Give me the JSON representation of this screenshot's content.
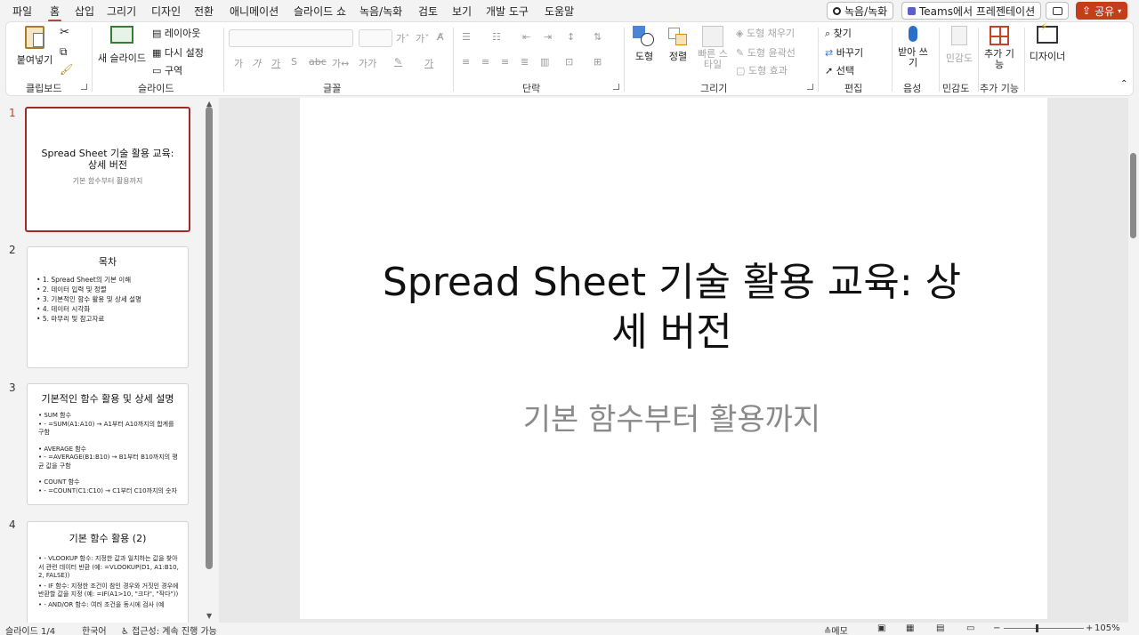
{
  "menu": {
    "items": [
      "파일",
      "홈",
      "삽입",
      "그리기",
      "디자인",
      "전환",
      "애니메이션",
      "슬라이드 쇼",
      "녹음/녹화",
      "검토",
      "보기",
      "개발 도구",
      "도움말"
    ],
    "record_button": "녹음/녹화",
    "teams_button": "Teams에서 프레젠테이션",
    "share_button": "공유"
  },
  "ribbon": {
    "clipboard": {
      "paste": "붙여넣기",
      "label": "클립보드"
    },
    "slides": {
      "new_slide": "새 슬라이드",
      "layout": "레이아웃",
      "reset": "다시 설정",
      "section": "구역",
      "label": "슬라이드"
    },
    "font": {
      "label": "글꼴"
    },
    "paragraph": {
      "label": "단락"
    },
    "drawing": {
      "shapes": "도형",
      "arrange": "정렬",
      "quick_styles": "빠른 스타일",
      "fill": "도형 채우기",
      "outline": "도형 윤곽선",
      "effects": "도형 효과",
      "label": "그리기"
    },
    "editing": {
      "find": "찾기",
      "replace": "바꾸기",
      "select": "선택",
      "label": "편집"
    },
    "voice": {
      "dictate": "받아 쓰기",
      "label": "음성"
    },
    "sensitivity": {
      "button": "민감도",
      "label": "민감도"
    },
    "addins": {
      "button": "추가 기능",
      "label": "추가 기능"
    },
    "designer": {
      "button": "디자이너"
    }
  },
  "thumbnails": [
    {
      "num": "1",
      "title": "Spread Sheet 기술 활용 교육: 상세 버전",
      "subtitle": "기본 함수부터 활용까지"
    },
    {
      "num": "2",
      "title": "목차",
      "items": [
        "1. Spread Sheet의 기본 이해",
        "2. 데이터 입력 및 정렬",
        "3. 기본적인 함수 활용 및 상세 설명",
        "4. 데이터 시각화",
        "5. 마무리 및 참고자료"
      ]
    },
    {
      "num": "3",
      "title": "기본적인 함수 활용 및 상세 설명",
      "lines": [
        "• SUM 함수",
        "• - =SUM(A1:A10) → A1부터 A10까지의 합계를 구함",
        "",
        "• AVERAGE 함수",
        "• - =AVERAGE(B1:B10) → B1부터 B10까지의 평균 값을 구함",
        "",
        "• COUNT 함수",
        "• - =COUNT(C1:C10) → C1부터 C10까지의 숫자"
      ]
    },
    {
      "num": "4",
      "title": "기본 함수 활용 (2)",
      "lines": [
        "• - VLOOKUP 함수: 지정한 값과 일치하는 값을 찾아서 관련 데이터 반환 (예: =VLOOKUP(D1, A1:B10, 2, FALSE))",
        "• - IF 함수: 지정한 조건이 참인 경우와 거짓인 경우에 반환할 값을 지정 (예: =IF(A1>10, \"크다\", \"작다\"))",
        "• - AND/OR 함수: 여러 조건을 동시에 검사 (예"
      ]
    }
  ],
  "slide": {
    "title_line1": "Spread Sheet 기술 활용 교육: 상",
    "title_line2": "세 버전",
    "subtitle": "기본 함수부터 활용까지"
  },
  "status": {
    "slide_count": "슬라이드 1/4",
    "language": "한국어",
    "accessibility": "접근성: 계속 진행 가능",
    "notes": "메모",
    "zoom": "105%"
  }
}
